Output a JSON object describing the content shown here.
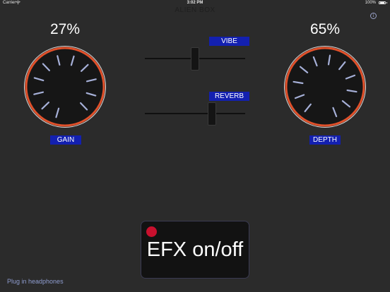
{
  "status_bar": {
    "carrier": "Carrier",
    "time": "3:02 PM",
    "battery": "100%",
    "battery_level": 1.0
  },
  "app": {
    "title": "ALIEN BOX",
    "info_glyph": "i"
  },
  "knobs": {
    "gain": {
      "percent_text": "27%",
      "value": 0.27,
      "label": "GAIN"
    },
    "depth": {
      "percent_text": "65%",
      "value": 0.65,
      "label": "DEPTH"
    }
  },
  "sliders": {
    "vibe": {
      "label": "VIBE",
      "value": 0.5
    },
    "reverb": {
      "label": "REVERB",
      "value": 0.67
    }
  },
  "efx": {
    "label": "EFX on/off",
    "led_color": "#c8102e"
  },
  "hint": "Plug in headphones",
  "colors": {
    "background": "#2b2b2b",
    "label_bg": "#1320b0",
    "knob_ring": "#e0502a",
    "tick": "#a6b0d8"
  },
  "icons": {
    "wifi": "wifi-icon",
    "battery": "battery-icon",
    "info": "info-icon"
  }
}
